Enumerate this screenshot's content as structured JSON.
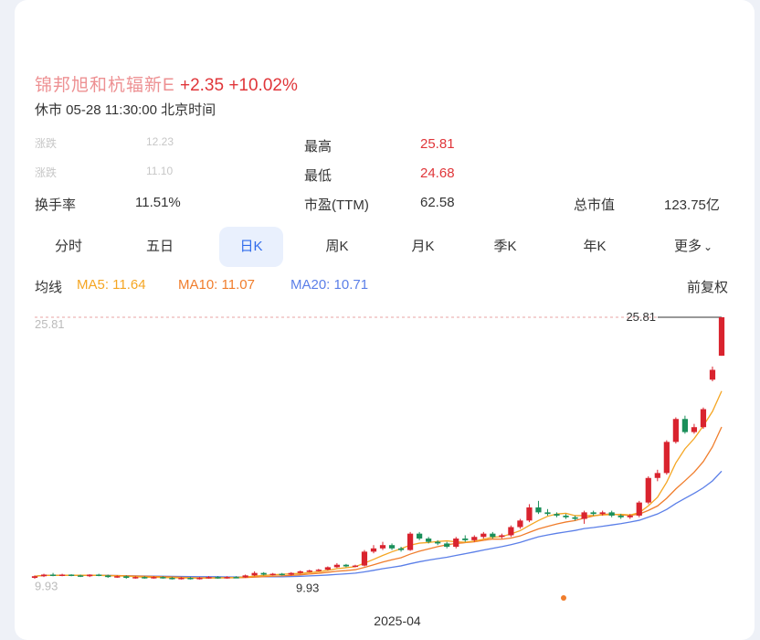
{
  "header": {
    "name_blurred": "锦邦旭和杭辐新E",
    "change": "+2.35",
    "change_pct": "+10.02%"
  },
  "status": "休市 05-28 11:30:00 北京时间",
  "stats": {
    "blur1_label": "涨跌",
    "blur1_value": "12.23",
    "blur2_label": "涨跌",
    "blur2_value": "11.10",
    "high_label": "最高",
    "high_value": "25.81",
    "low_label": "最低",
    "low_value": "24.68",
    "turnover_label": "换手率",
    "turnover_value": "11.51%",
    "pe_label": "市盈(TTM)",
    "pe_value": "62.58",
    "mcap_label": "总市值",
    "mcap_value": "123.75亿"
  },
  "tabs": [
    "分时",
    "五日",
    "日K",
    "周K",
    "月K",
    "季K",
    "年K",
    "更多"
  ],
  "active_tab": "日K",
  "ma": {
    "label": "均线",
    "ma5": "MA5: 11.64",
    "ma10": "MA10: 11.07",
    "ma20": "MA20: 10.71",
    "adjust": "前复权"
  },
  "colors": {
    "up": "#d9232e",
    "down": "#1a8f5a",
    "ma5": "#f5a623",
    "ma10": "#f07d2c",
    "ma20": "#5b7fe8",
    "active_tab": "#2f6bec"
  },
  "chart_data": {
    "type": "candlestick",
    "ylim": [
      9.4,
      25.81
    ],
    "top_label": "25.81",
    "bottom_label": "9.93",
    "left_top_label": "25.81",
    "left_bottom_label": "9.93",
    "x_tick": "2025-04",
    "candles": [
      [
        9.9,
        10.0,
        9.85,
        10.05
      ],
      [
        10.0,
        10.1,
        9.95,
        10.15
      ],
      [
        10.1,
        10.05,
        10.0,
        10.2
      ],
      [
        10.05,
        10.1,
        10.0,
        10.15
      ],
      [
        10.1,
        10.05,
        10.0,
        10.12
      ],
      [
        10.05,
        10.0,
        9.95,
        10.1
      ],
      [
        10.0,
        10.1,
        9.95,
        10.12
      ],
      [
        10.1,
        10.05,
        10.0,
        10.15
      ],
      [
        10.05,
        9.95,
        9.9,
        10.1
      ],
      [
        9.95,
        10.0,
        9.9,
        10.05
      ],
      [
        10.0,
        9.9,
        9.85,
        10.05
      ],
      [
        9.9,
        9.95,
        9.85,
        10.0
      ],
      [
        9.95,
        9.9,
        9.85,
        10.0
      ],
      [
        9.9,
        9.95,
        9.85,
        10.0
      ],
      [
        9.95,
        9.9,
        9.85,
        10.0
      ],
      [
        9.9,
        9.85,
        9.8,
        9.95
      ],
      [
        9.85,
        9.9,
        9.8,
        9.95
      ],
      [
        9.9,
        9.85,
        9.8,
        9.95
      ],
      [
        9.85,
        9.9,
        9.8,
        9.95
      ],
      [
        9.9,
        9.95,
        9.85,
        10.0
      ],
      [
        9.95,
        9.9,
        9.85,
        10.0
      ],
      [
        9.9,
        9.95,
        9.85,
        10.0
      ],
      [
        9.95,
        9.93,
        9.9,
        10.0
      ],
      [
        9.93,
        10.05,
        9.9,
        10.1
      ],
      [
        10.05,
        10.2,
        10.0,
        10.3
      ],
      [
        10.2,
        10.1,
        10.05,
        10.25
      ],
      [
        10.1,
        10.15,
        10.05,
        10.2
      ],
      [
        10.15,
        10.1,
        10.05,
        10.2
      ],
      [
        10.1,
        10.2,
        10.05,
        10.25
      ],
      [
        10.2,
        10.3,
        10.15,
        10.35
      ],
      [
        10.3,
        10.35,
        10.25,
        10.4
      ],
      [
        10.35,
        10.4,
        10.3,
        10.45
      ],
      [
        10.4,
        10.55,
        10.35,
        10.6
      ],
      [
        10.55,
        10.7,
        10.5,
        10.8
      ],
      [
        10.7,
        10.6,
        10.55,
        10.75
      ],
      [
        10.6,
        10.65,
        10.55,
        10.7
      ],
      [
        10.65,
        11.5,
        10.6,
        11.6
      ],
      [
        11.5,
        11.7,
        11.4,
        11.9
      ],
      [
        11.7,
        11.9,
        11.6,
        12.1
      ],
      [
        11.9,
        11.7,
        11.6,
        12.0
      ],
      [
        11.7,
        11.6,
        11.5,
        11.8
      ],
      [
        11.6,
        12.6,
        11.55,
        12.7
      ],
      [
        12.6,
        12.3,
        12.2,
        12.7
      ],
      [
        12.3,
        12.1,
        12.0,
        12.4
      ],
      [
        12.1,
        12.0,
        11.9,
        12.2
      ],
      [
        12.0,
        11.8,
        11.7,
        12.1
      ],
      [
        11.8,
        12.3,
        11.7,
        12.4
      ],
      [
        12.3,
        12.2,
        12.1,
        12.5
      ],
      [
        12.2,
        12.4,
        12.1,
        12.5
      ],
      [
        12.4,
        12.6,
        12.3,
        12.7
      ],
      [
        12.6,
        12.4,
        12.3,
        12.7
      ],
      [
        12.4,
        12.5,
        12.3,
        12.6
      ],
      [
        12.5,
        13.0,
        12.4,
        13.1
      ],
      [
        13.0,
        13.4,
        12.9,
        13.5
      ],
      [
        13.4,
        14.2,
        13.3,
        14.4
      ],
      [
        14.2,
        13.9,
        13.8,
        14.6
      ],
      [
        13.9,
        13.8,
        13.7,
        14.1
      ],
      [
        13.8,
        13.7,
        13.6,
        13.9
      ],
      [
        13.7,
        13.6,
        13.5,
        13.8
      ],
      [
        13.6,
        13.5,
        13.4,
        13.7
      ],
      [
        13.5,
        13.9,
        13.2,
        14.0
      ],
      [
        13.9,
        13.8,
        13.7,
        14.0
      ],
      [
        13.8,
        13.9,
        13.7,
        14.0
      ],
      [
        13.9,
        13.7,
        13.6,
        14.0
      ],
      [
        13.7,
        13.6,
        13.5,
        13.8
      ],
      [
        13.6,
        13.7,
        13.5,
        13.8
      ],
      [
        13.7,
        14.5,
        13.6,
        14.6
      ],
      [
        14.5,
        16.0,
        14.4,
        16.1
      ],
      [
        16.0,
        16.3,
        15.8,
        16.5
      ],
      [
        16.3,
        18.2,
        16.2,
        18.3
      ],
      [
        18.2,
        19.6,
        18.1,
        19.7
      ],
      [
        19.6,
        18.8,
        18.7,
        19.8
      ],
      [
        18.8,
        19.1,
        18.7,
        19.3
      ],
      [
        19.1,
        20.2,
        19.0,
        20.3
      ],
      [
        22.0,
        22.6,
        21.9,
        22.8
      ],
      [
        23.46,
        25.81,
        23.46,
        25.81
      ]
    ]
  }
}
